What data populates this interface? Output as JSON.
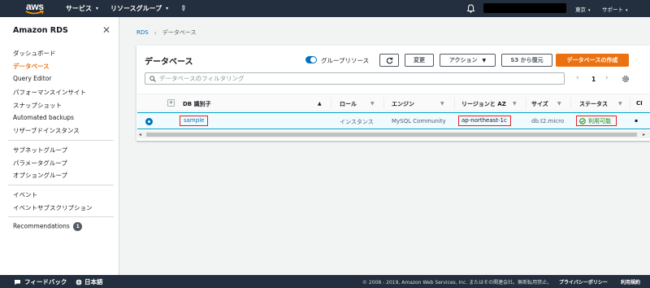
{
  "topnav": {
    "logo_text": "aws",
    "services_label": "サービス",
    "resource_groups_label": "リソースグループ",
    "region_label": "東京",
    "support_label": "サポート"
  },
  "sidebar": {
    "title": "Amazon RDS",
    "items": [
      "ダッシュボード",
      "データベース",
      "Query Editor",
      "パフォーマンスインサイト",
      "スナップショット",
      "Automated backups",
      "リザーブドインスタンス",
      "サブネットグループ",
      "パラメータグループ",
      "オプショングループ",
      "イベント",
      "イベントサブスクリプション",
      "Recommendations"
    ],
    "active_item": "データベース",
    "recommendations_count": "1"
  },
  "breadcrumb": {
    "root": "RDS",
    "current": "データベース"
  },
  "panel": {
    "title": "データベース",
    "group_resources_label": "グループリソース",
    "modify_label": "変更",
    "actions_label": "アクション",
    "restore_s3_label": "S3 から復元",
    "create_label": "データベースの作成",
    "filter_placeholder": "データベースのフィルタリング",
    "page_number": "1"
  },
  "table": {
    "headers": [
      "DB 識別子",
      "ロール",
      "エンジン",
      "リージョンと AZ",
      "サイズ",
      "ステータス",
      "CI"
    ],
    "rows": [
      {
        "identifier": "sample",
        "role": "インスタンス",
        "engine": "MySQL Community",
        "region_az": "ap-northeast-1c",
        "size": "db.t2.micro",
        "status": "利用可能"
      }
    ]
  },
  "footer": {
    "feedback_label": "フィードバック",
    "language_label": "日本語",
    "copyright": "© 2008 - 2019, Amazon Web Services, Inc. またはその関連会社。無断転用禁止。",
    "privacy_label": "プライバシーポリシー",
    "terms_label": "利用規約"
  },
  "colors": {
    "nav_bg": "#232f3e",
    "accent_orange": "#ec7211",
    "link_blue": "#0073bb",
    "status_green": "#1d8102",
    "highlight_red": "#e02424"
  }
}
